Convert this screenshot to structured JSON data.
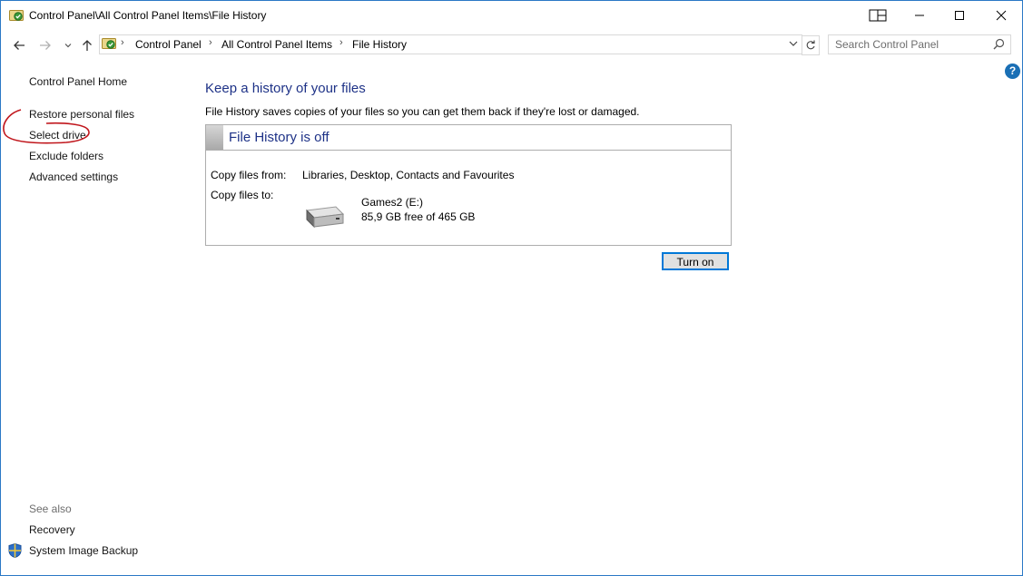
{
  "window": {
    "title": "Control Panel\\All Control Panel Items\\File History"
  },
  "nav": {
    "breadcrumbs": [
      "Control Panel",
      "All Control Panel Items",
      "File History"
    ],
    "search_placeholder": "Search Control Panel"
  },
  "help": {
    "label": "?"
  },
  "sidebar": {
    "home": "Control Panel Home",
    "links": [
      "Restore personal files",
      "Select drive",
      "Exclude folders",
      "Advanced settings"
    ],
    "see_also_label": "See also",
    "see_also": [
      "Recovery",
      "System Image Backup"
    ]
  },
  "main": {
    "heading": "Keep a history of your files",
    "description": "File History saves copies of your files so you can get them back if they're lost or damaged.",
    "status": "File History is off",
    "copy_from_label": "Copy files from:",
    "copy_from_value": "Libraries, Desktop, Contacts and Favourites",
    "copy_to_label": "Copy files to:",
    "drive_name": "Games2 (E:)",
    "drive_free": "85,9 GB free of 465 GB",
    "turn_on_button": "Turn on"
  },
  "colors": {
    "heading": "#1e3287",
    "window_border": "#2b79c6",
    "annotation": "#c0161c",
    "help": "#1a6fb5"
  },
  "icons": [
    "control-panel-icon",
    "snap-layout-icon",
    "minimize-icon",
    "maximize-icon",
    "close-icon",
    "back-arrow-icon",
    "forward-arrow-icon",
    "recent-dropdown-icon",
    "up-arrow-icon",
    "chevron-down-icon",
    "refresh-icon",
    "search-icon",
    "help-icon",
    "drive-icon",
    "uac-shield-icon"
  ]
}
